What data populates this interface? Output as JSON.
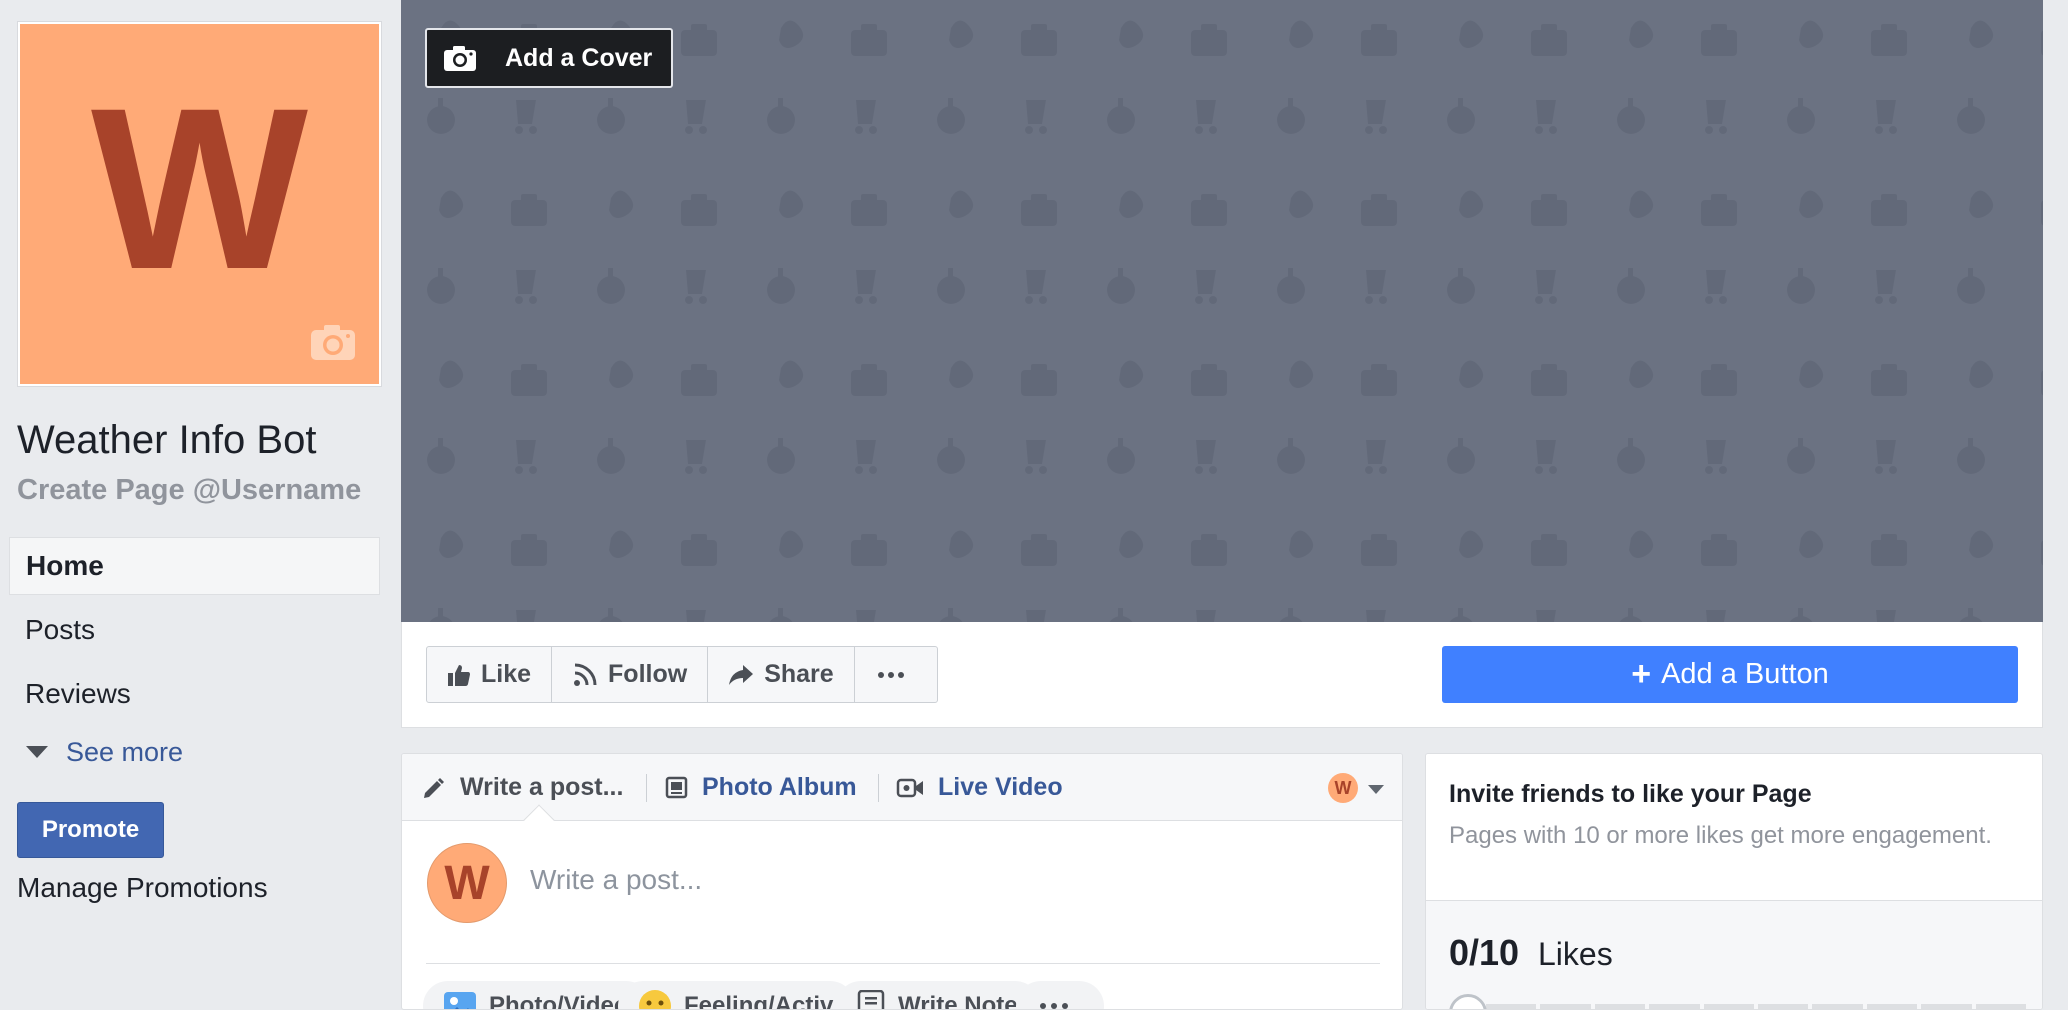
{
  "page": {
    "name": "Weather Info Bot",
    "username_link": "Create Page @Username",
    "avatar_letter": "W",
    "brand_color": "#ffaa77",
    "letter_color": "#a8432a"
  },
  "sidebar": {
    "items": [
      {
        "label": "Home",
        "active": true
      },
      {
        "label": "Posts",
        "active": false
      },
      {
        "label": "Reviews",
        "active": false
      }
    ],
    "see_more": "See more",
    "promote": "Promote",
    "manage_promotions": "Manage Promotions"
  },
  "cover": {
    "add_cover_label": "Add a Cover",
    "background_color": "#6b7282"
  },
  "actions": {
    "like": "Like",
    "follow": "Follow",
    "share": "Share",
    "more_icon": "ellipsis-icon",
    "add_button": "Add a Button",
    "add_button_color": "#4080ff"
  },
  "composer": {
    "tabs": [
      {
        "label": "Write a post...",
        "icon": "pencil-icon"
      },
      {
        "label": "Photo Album",
        "icon": "photo-album-icon"
      },
      {
        "label": "Live Video",
        "icon": "video-camera-icon"
      }
    ],
    "avatar_letter": "W",
    "placeholder": "Write a post...",
    "chips": [
      {
        "label": "Photo/Video",
        "icon": "photo-icon"
      },
      {
        "label": "Feeling/Activ",
        "icon": "smiley-icon"
      },
      {
        "label": "Write Note",
        "icon": "note-icon"
      }
    ]
  },
  "invite": {
    "title": "Invite friends to like your Page",
    "subtitle": "Pages with 10 or more likes get more engagement.",
    "likes_count": "0/10",
    "likes_label": "Likes",
    "progress": 0
  }
}
